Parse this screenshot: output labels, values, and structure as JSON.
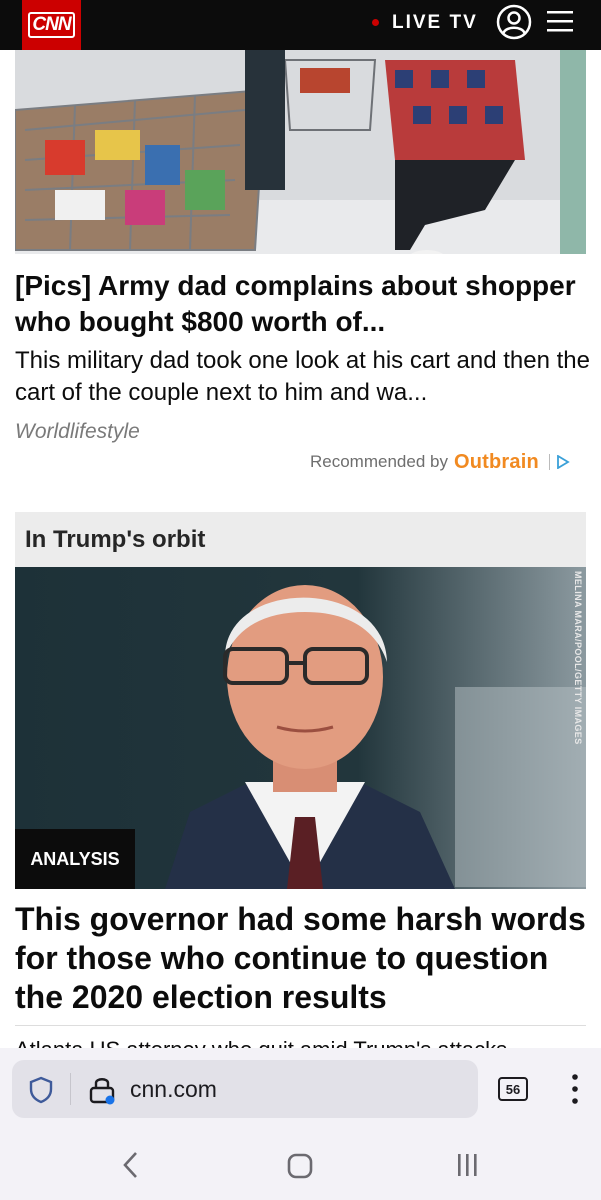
{
  "header": {
    "logo": "CNN",
    "live_label": "LIVE TV",
    "colors": {
      "brand_red": "#cc0000",
      "bar": "#0c0c0c"
    },
    "icons": [
      "user-icon",
      "menu-icon"
    ]
  },
  "ad": {
    "title": "[Pics] Army dad complains about shopper who bought $800 worth of...",
    "description": "This military dad took one look at his cart and then the cart of the couple next to him and wa...",
    "source": "Worldlifestyle",
    "recommended_label": "Recommended by",
    "recommended_brand": "Outbrain",
    "brand_color": "#f18a21"
  },
  "section": {
    "title": "In Trump's orbit",
    "photo_credit": "MELINA MARA/POOL/GETTY IMAGES",
    "badge": "ANALYSIS",
    "headline": "This governor had some harsh words for those who continue to question the 2020 election results",
    "next_headline": "Atlanta US attorney who quit amid Trump's attacks"
  },
  "browser": {
    "url": "cnn.com",
    "tab_count": "56",
    "icons": [
      "shield-icon",
      "lock-icon",
      "more-icon",
      "back-icon",
      "home-icon",
      "recents-icon"
    ]
  }
}
